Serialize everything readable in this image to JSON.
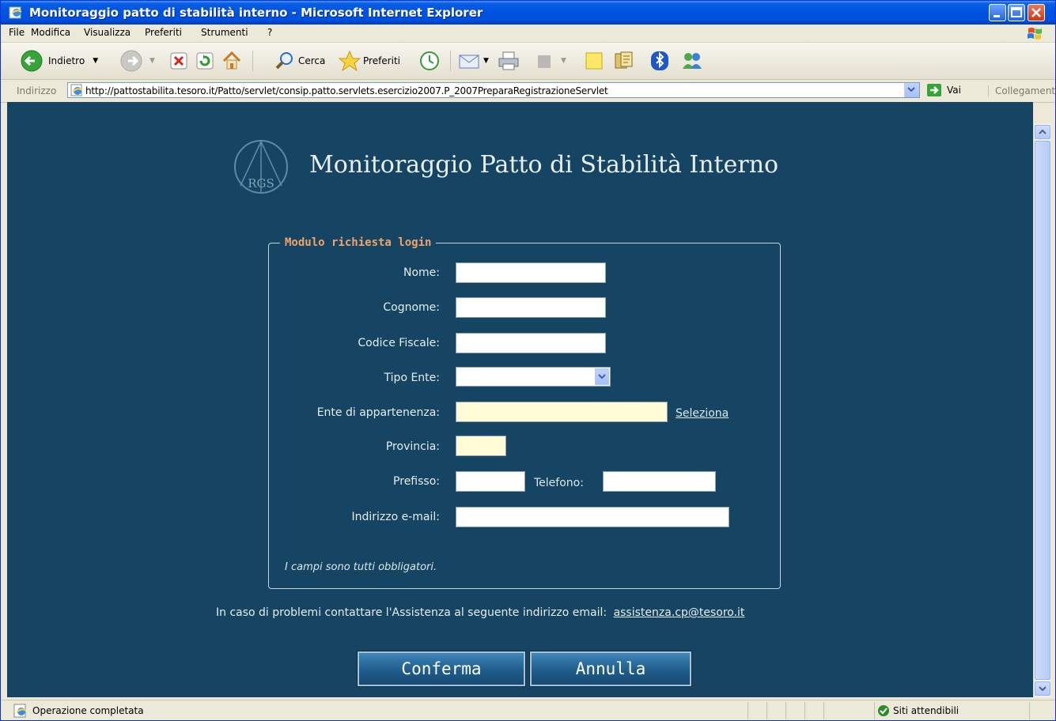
{
  "window": {
    "title": "Monitoraggio patto di stabilità interno - Microsoft Internet Explorer"
  },
  "menu": {
    "items": [
      "File",
      "Modifica",
      "Visualizza",
      "Preferiti",
      "Strumenti",
      "?"
    ]
  },
  "toolbar": {
    "back_label": "Indietro",
    "search_label": "Cerca",
    "favorites_label": "Preferiti"
  },
  "address": {
    "label": "Indirizzo",
    "url": "http://pattostabilita.tesoro.it/Patto/servlet/consip.patto.servlets.esercizio2007.P_2007PreparaRegistrazioneServlet",
    "go_label": "Vai",
    "links_label": "Collegamenti"
  },
  "page": {
    "logo_text": "RGS",
    "title": "Monitoraggio Patto di Stabilità Interno",
    "form": {
      "legend": "Modulo richiesta login",
      "nome_label": "Nome:",
      "nome_value": "",
      "cognome_label": "Cognome:",
      "cognome_value": "",
      "cf_label": "Codice Fiscale:",
      "cf_value": "",
      "tipo_ente_label": "Tipo Ente:",
      "tipo_ente_value": "",
      "ente_label": "Ente di appartenenza:",
      "ente_value": "",
      "seleziona_label": "Seleziona",
      "provincia_label": "Provincia:",
      "provincia_value": "",
      "prefisso_label": "Prefisso:",
      "prefisso_value": "",
      "telefono_label": "Telefono:",
      "telefono_value": "",
      "email_label": "Indirizzo e-mail:",
      "email_value": "",
      "note": "I campi sono tutti obbligatori."
    },
    "help_text": "In caso di problemi contattare l'Assistenza al seguente indirizzo email:",
    "help_email": "assistenza.cp@tesoro.it",
    "confirm_label": "Conferma",
    "cancel_label": "Annulla"
  },
  "status": {
    "text": "Operazione completata",
    "zone": "Siti attendibili"
  },
  "colors": {
    "content_bg": "#154563",
    "legend": "#f2a36a",
    "titlebar": "#0054e3"
  }
}
